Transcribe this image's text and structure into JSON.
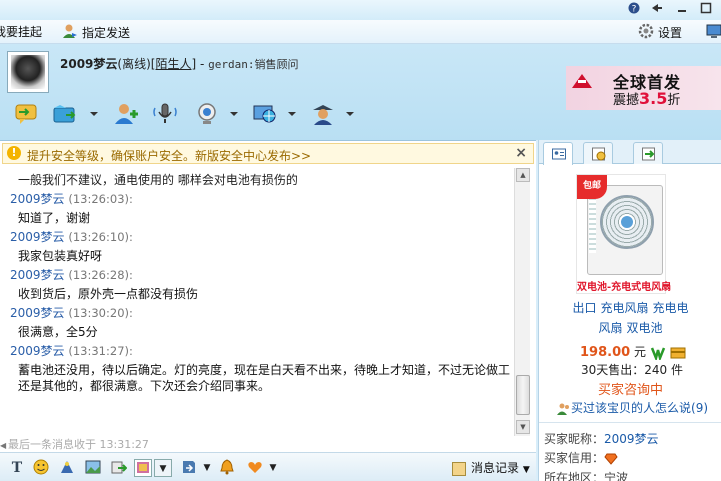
{
  "topbar": {
    "settings_label": "设置"
  },
  "menu": {
    "item1": "我要挂起",
    "item2": "指定发送"
  },
  "contact": {
    "name": "2009梦云",
    "status": "(离线)",
    "tag": "[陌生人]",
    "separator": " - ",
    "signature": "gerdan:销售顾问"
  },
  "ad": {
    "line1": "全球首发",
    "line2_prefix": "震撼",
    "line2_num": "3.5",
    "line2_suffix": "折"
  },
  "notice": {
    "text": "提升安全等级，确保账户安全。新版安全中心发布>>",
    "close": "×"
  },
  "messages": {
    "first_text": "一般我们不建议，通电使用的   哪样会对电池有损伤的",
    "items": [
      {
        "sender": "2009梦云",
        "time": "(13:26:03):",
        "text": "知道了，谢谢"
      },
      {
        "sender": "2009梦云",
        "time": "(13:26:10):",
        "text": "我家包装真好呀"
      },
      {
        "sender": "2009梦云",
        "time": "(13:26:28):",
        "text": "收到货后，原外壳一点都没有损伤"
      },
      {
        "sender": "2009梦云",
        "time": "(13:30:20):",
        "text": "很满意，全5分"
      },
      {
        "sender": "2009梦云",
        "time": "(13:31:27):",
        "text": "蓄电池还没用，待以后确定。灯的亮度，现在是白天看不出来，待晚上才知道，不过无论做工还是其他的，都很满意。下次还会介绍同事来。"
      }
    ]
  },
  "lastmsg": "最后一条消息收于 13:31:27",
  "history_label": "消息记录",
  "product": {
    "ribbon": "包邮",
    "caption": "双电池-充电式电风扇",
    "links": [
      "出口",
      "充电风扇",
      "充电电",
      "风扇",
      "双电池"
    ],
    "price": "198.00",
    "price_unit": "元",
    "sold_label": "30天售出：",
    "sold_count": "240",
    "sold_unit": "件",
    "consult": "买家咨询中",
    "bought_label": "买过该宝贝的人怎么说",
    "bought_count": "(9)"
  },
  "buyer": {
    "nick_label": "买家昵称：",
    "nick": "2009梦云",
    "credit_label": "买家信用：",
    "region_label": "所在地区：",
    "region": "宁波"
  }
}
